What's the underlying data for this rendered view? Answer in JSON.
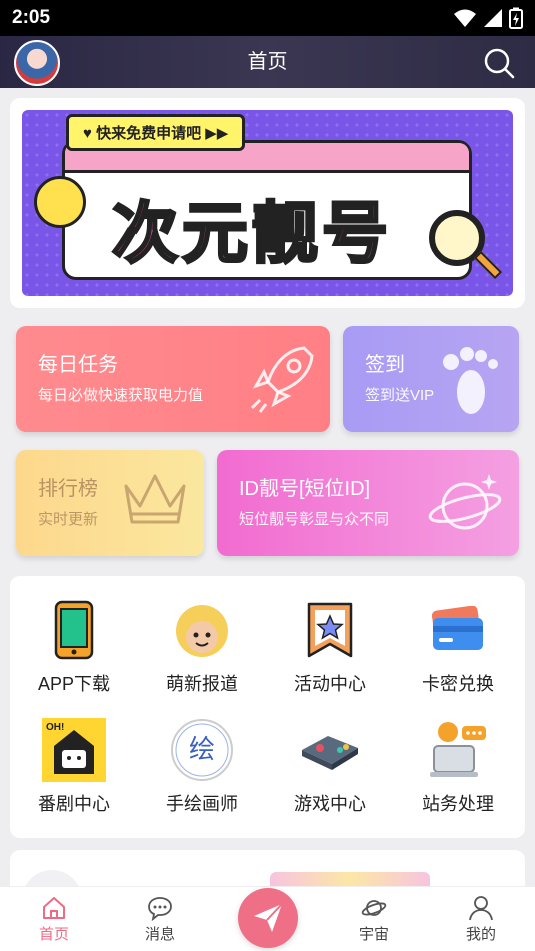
{
  "status_bar": {
    "time": "2:05"
  },
  "header": {
    "title": "首页"
  },
  "banner": {
    "pill_text": "♥ 快来免费申请吧 ▶▶",
    "headline": "次元靓号"
  },
  "tiles": {
    "daily": {
      "title": "每日任务",
      "subtitle": "每日必做快速获取电力值"
    },
    "sign": {
      "title": "签到",
      "subtitle": "签到送VIP"
    },
    "rank": {
      "title": "排行榜",
      "subtitle": "实时更新"
    },
    "id": {
      "title": "ID靓号[短位ID]",
      "subtitle": "短位靓号彰显与众不同"
    }
  },
  "grid": {
    "items": [
      {
        "label": "APP下载",
        "icon": "phone-icon"
      },
      {
        "label": "萌新报道",
        "icon": "mascot-icon"
      },
      {
        "label": "活动中心",
        "icon": "star-bookmark-icon"
      },
      {
        "label": "卡密兑换",
        "icon": "card-icon"
      },
      {
        "label": "番剧中心",
        "icon": "tv-house-icon"
      },
      {
        "label": "手绘画师",
        "icon": "paint-badge-icon"
      },
      {
        "label": "游戏中心",
        "icon": "gamepad-icon"
      },
      {
        "label": "站务处理",
        "icon": "support-icon"
      }
    ]
  },
  "tabbar": {
    "items": [
      {
        "label": "首页",
        "icon": "home-icon"
      },
      {
        "label": "消息",
        "icon": "message-icon"
      },
      {
        "label": "宇宙",
        "icon": "planet-icon"
      },
      {
        "label": "我的",
        "icon": "user-icon"
      }
    ]
  },
  "colors": {
    "accent": "#f06a86",
    "header_bg": "#2f2c48"
  }
}
